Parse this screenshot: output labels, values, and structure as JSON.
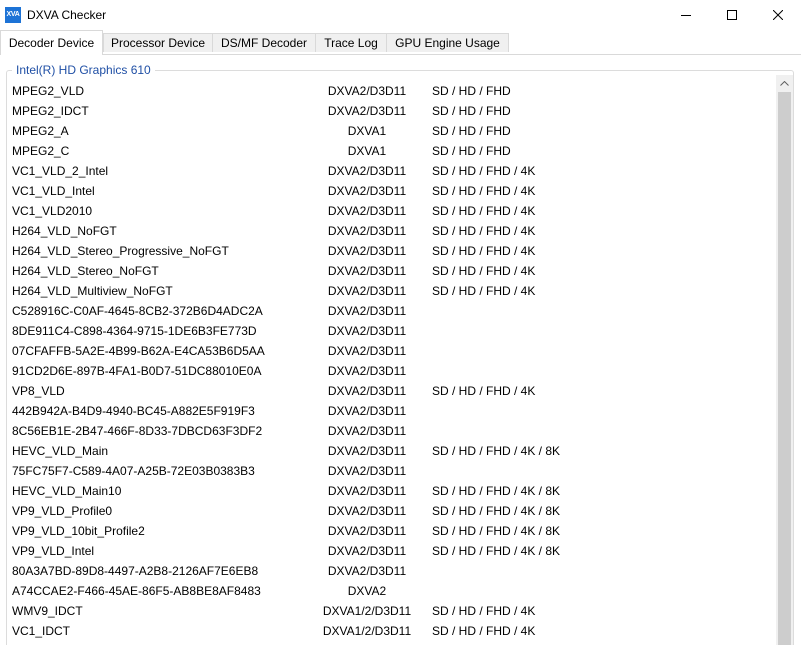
{
  "window": {
    "title": "DXVA Checker",
    "icon_text": "XVA",
    "icon_color": "#1d73d6"
  },
  "tabs": [
    {
      "label": "Decoder Device",
      "active": true
    },
    {
      "label": "Processor Device",
      "active": false
    },
    {
      "label": "DS/MF Decoder",
      "active": false
    },
    {
      "label": "Trace Log",
      "active": false
    },
    {
      "label": "GPU Engine Usage",
      "active": false
    }
  ],
  "group": {
    "title": "Intel(R) HD Graphics 610",
    "title_color": "#1f4fa5"
  },
  "rows": [
    {
      "name": "MPEG2_VLD",
      "api": "DXVA2/D3D11",
      "res": "SD / HD / FHD"
    },
    {
      "name": "MPEG2_IDCT",
      "api": "DXVA2/D3D11",
      "res": "SD / HD / FHD"
    },
    {
      "name": "MPEG2_A",
      "api": "DXVA1",
      "res": "SD / HD / FHD"
    },
    {
      "name": "MPEG2_C",
      "api": "DXVA1",
      "res": "SD / HD / FHD"
    },
    {
      "name": "VC1_VLD_2_Intel",
      "api": "DXVA2/D3D11",
      "res": "SD / HD / FHD / 4K"
    },
    {
      "name": "VC1_VLD_Intel",
      "api": "DXVA2/D3D11",
      "res": "SD / HD / FHD / 4K"
    },
    {
      "name": "VC1_VLD2010",
      "api": "DXVA2/D3D11",
      "res": "SD / HD / FHD / 4K"
    },
    {
      "name": "H264_VLD_NoFGT",
      "api": "DXVA2/D3D11",
      "res": "SD / HD / FHD / 4K"
    },
    {
      "name": "H264_VLD_Stereo_Progressive_NoFGT",
      "api": "DXVA2/D3D11",
      "res": "SD / HD / FHD / 4K"
    },
    {
      "name": "H264_VLD_Stereo_NoFGT",
      "api": "DXVA2/D3D11",
      "res": "SD / HD / FHD / 4K"
    },
    {
      "name": "H264_VLD_Multiview_NoFGT",
      "api": "DXVA2/D3D11",
      "res": "SD / HD / FHD / 4K"
    },
    {
      "name": "C528916C-C0AF-4645-8CB2-372B6D4ADC2A",
      "api": "DXVA2/D3D11",
      "res": ""
    },
    {
      "name": "8DE911C4-C898-4364-9715-1DE6B3FE773D",
      "api": "DXVA2/D3D11",
      "res": ""
    },
    {
      "name": "07CFAFFB-5A2E-4B99-B62A-E4CA53B6D5AA",
      "api": "DXVA2/D3D11",
      "res": ""
    },
    {
      "name": "91CD2D6E-897B-4FA1-B0D7-51DC88010E0A",
      "api": "DXVA2/D3D11",
      "res": ""
    },
    {
      "name": "VP8_VLD",
      "api": "DXVA2/D3D11",
      "res": "SD / HD / FHD / 4K"
    },
    {
      "name": "442B942A-B4D9-4940-BC45-A882E5F919F3",
      "api": "DXVA2/D3D11",
      "res": ""
    },
    {
      "name": "8C56EB1E-2B47-466F-8D33-7DBCD63F3DF2",
      "api": "DXVA2/D3D11",
      "res": ""
    },
    {
      "name": "HEVC_VLD_Main",
      "api": "DXVA2/D3D11",
      "res": "SD / HD / FHD / 4K / 8K"
    },
    {
      "name": "75FC75F7-C589-4A07-A25B-72E03B0383B3",
      "api": "DXVA2/D3D11",
      "res": ""
    },
    {
      "name": "HEVC_VLD_Main10",
      "api": "DXVA2/D3D11",
      "res": "SD / HD / FHD / 4K / 8K"
    },
    {
      "name": "VP9_VLD_Profile0",
      "api": "DXVA2/D3D11",
      "res": "SD / HD / FHD / 4K / 8K"
    },
    {
      "name": "VP9_VLD_10bit_Profile2",
      "api": "DXVA2/D3D11",
      "res": "SD / HD / FHD / 4K / 8K"
    },
    {
      "name": "VP9_VLD_Intel",
      "api": "DXVA2/D3D11",
      "res": "SD / HD / FHD / 4K / 8K"
    },
    {
      "name": "80A3A7BD-89D8-4497-A2B8-2126AF7E6EB8",
      "api": "DXVA2/D3D11",
      "res": ""
    },
    {
      "name": "A74CCAE2-F466-45AE-86F5-AB8BE8AF8483",
      "api": "DXVA2",
      "res": ""
    },
    {
      "name": "WMV9_IDCT",
      "api": "DXVA1/2/D3D11",
      "res": "SD / HD / FHD / 4K"
    },
    {
      "name": "VC1_IDCT",
      "api": "DXVA1/2/D3D11",
      "res": "SD / HD / FHD / 4K"
    }
  ]
}
